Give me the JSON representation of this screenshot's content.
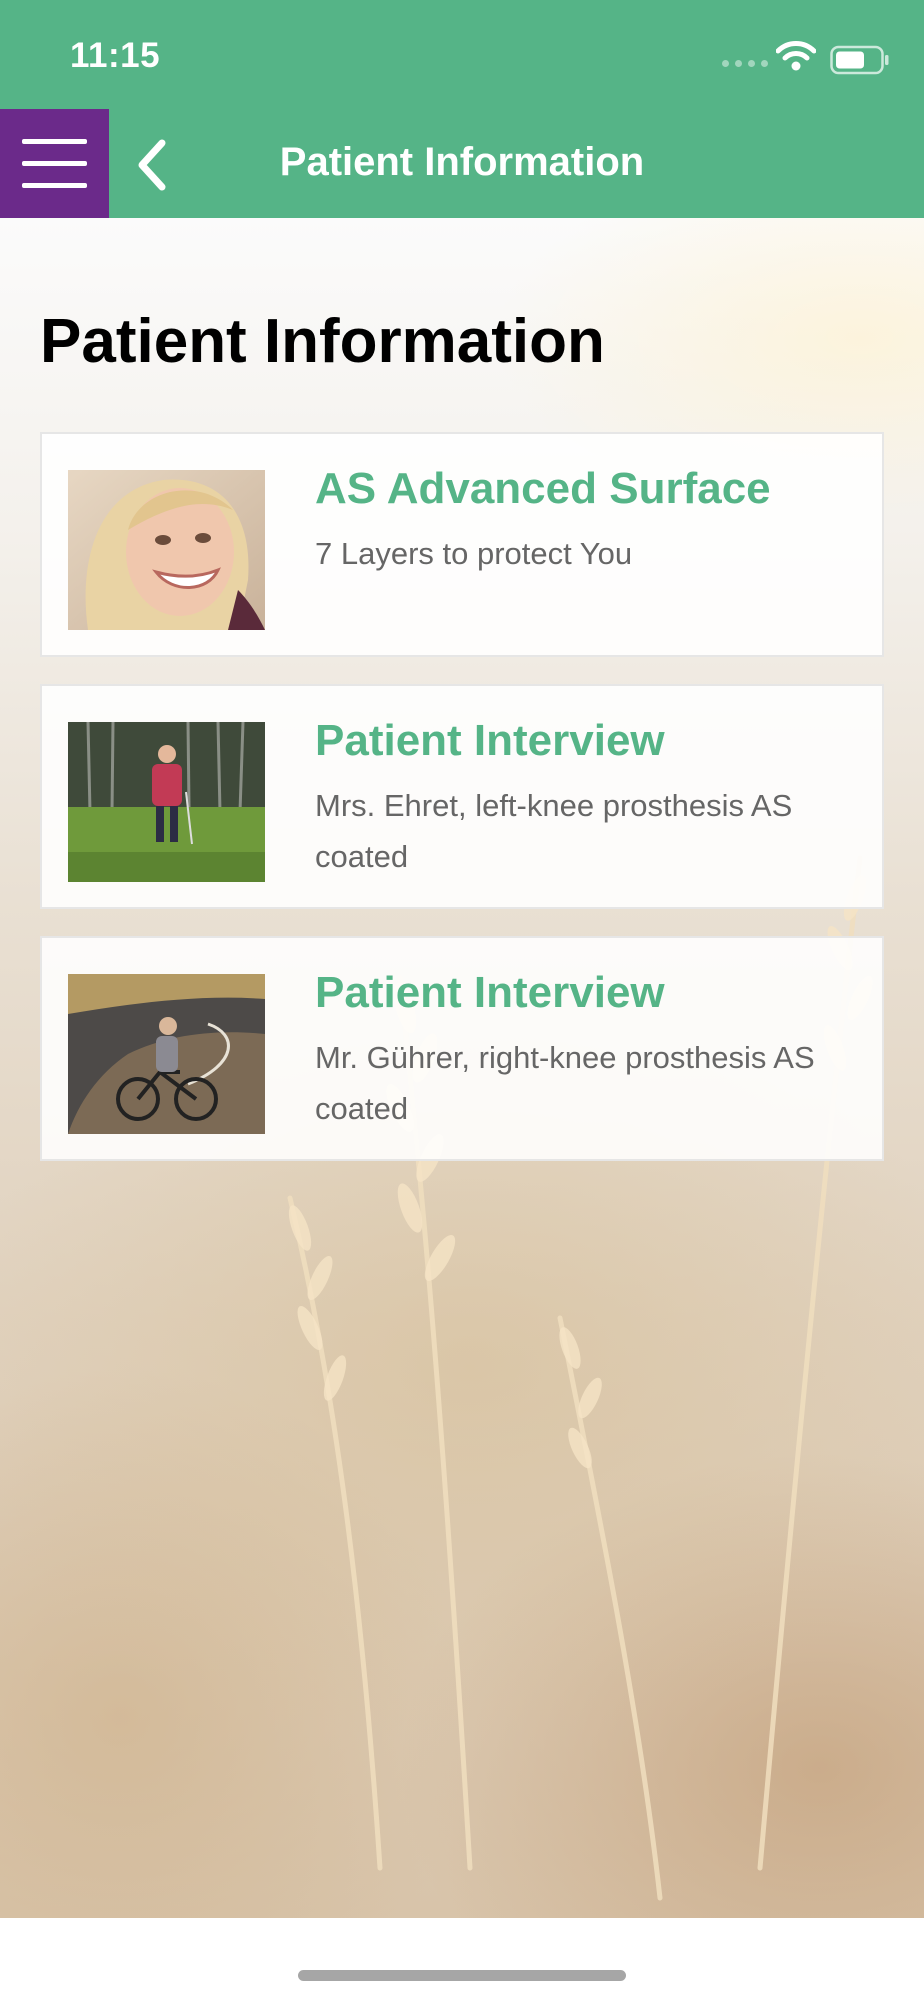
{
  "status_bar": {
    "time": "11:15"
  },
  "header": {
    "title": "Patient Information",
    "menu_icon": "hamburger-menu-icon",
    "back_icon": "chevron-left-icon",
    "background_color": "#55b487",
    "menu_color": "#6b2a8a"
  },
  "page": {
    "title": "Patient Information"
  },
  "cards": [
    {
      "title": "AS Advanced Surface",
      "subtitle": "7 Layers to protect You",
      "thumbnail": "smiling-woman"
    },
    {
      "title": "Patient Interview",
      "subtitle": "Mrs. Ehret, left-knee prosthesis AS coated",
      "thumbnail": "woman-walking"
    },
    {
      "title": "Patient Interview",
      "subtitle": "Mr. Gührer, right-knee prosthesis AS coated",
      "thumbnail": "man-cycling"
    }
  ],
  "colors": {
    "accent": "#55b487",
    "text_secondary": "#666666"
  }
}
